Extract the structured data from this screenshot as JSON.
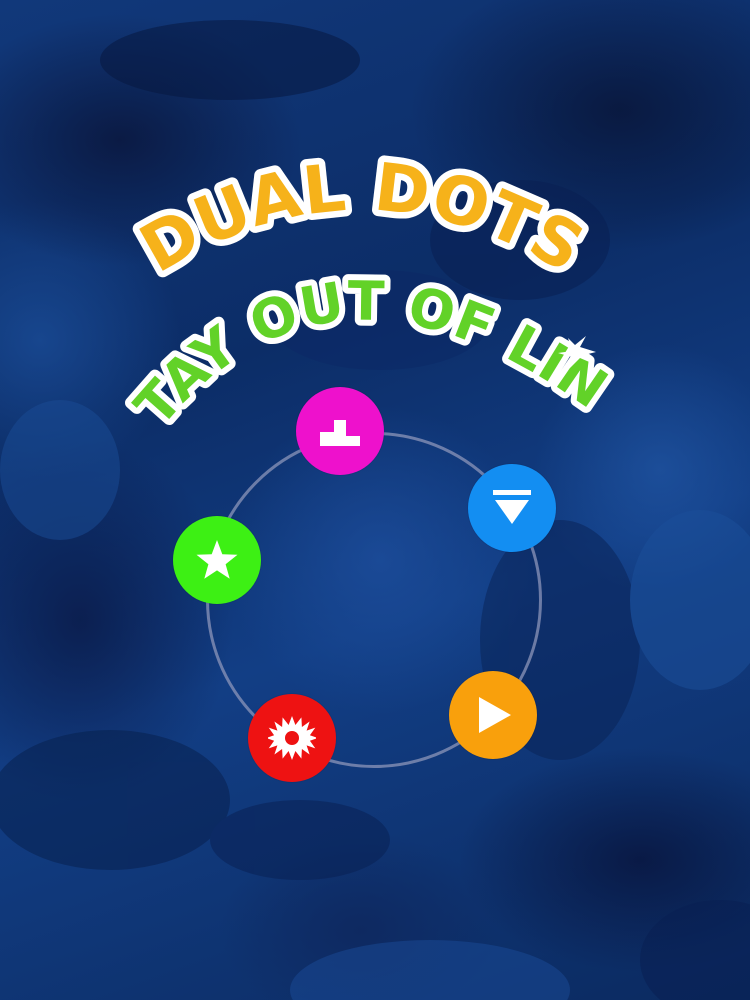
{
  "title": {
    "line1": "DUAL DOTS",
    "line2": "STAY OUT OF LINE"
  },
  "colors": {
    "title_line1": "#f6b21a",
    "title_line2": "#62d228",
    "title_outline": "#ffffff",
    "background": "#0f357a"
  },
  "menu": {
    "buttons": [
      {
        "id": "leaderboard",
        "icon": "podium-icon",
        "color": "#ee11cc"
      },
      {
        "id": "download",
        "icon": "download-arrow-icon",
        "color": "#138ef2"
      },
      {
        "id": "favorites",
        "icon": "star-icon",
        "color": "#3df014"
      },
      {
        "id": "play",
        "icon": "play-icon",
        "color": "#f9a00c"
      },
      {
        "id": "settings",
        "icon": "gear-icon",
        "color": "#ee1212"
      }
    ]
  }
}
